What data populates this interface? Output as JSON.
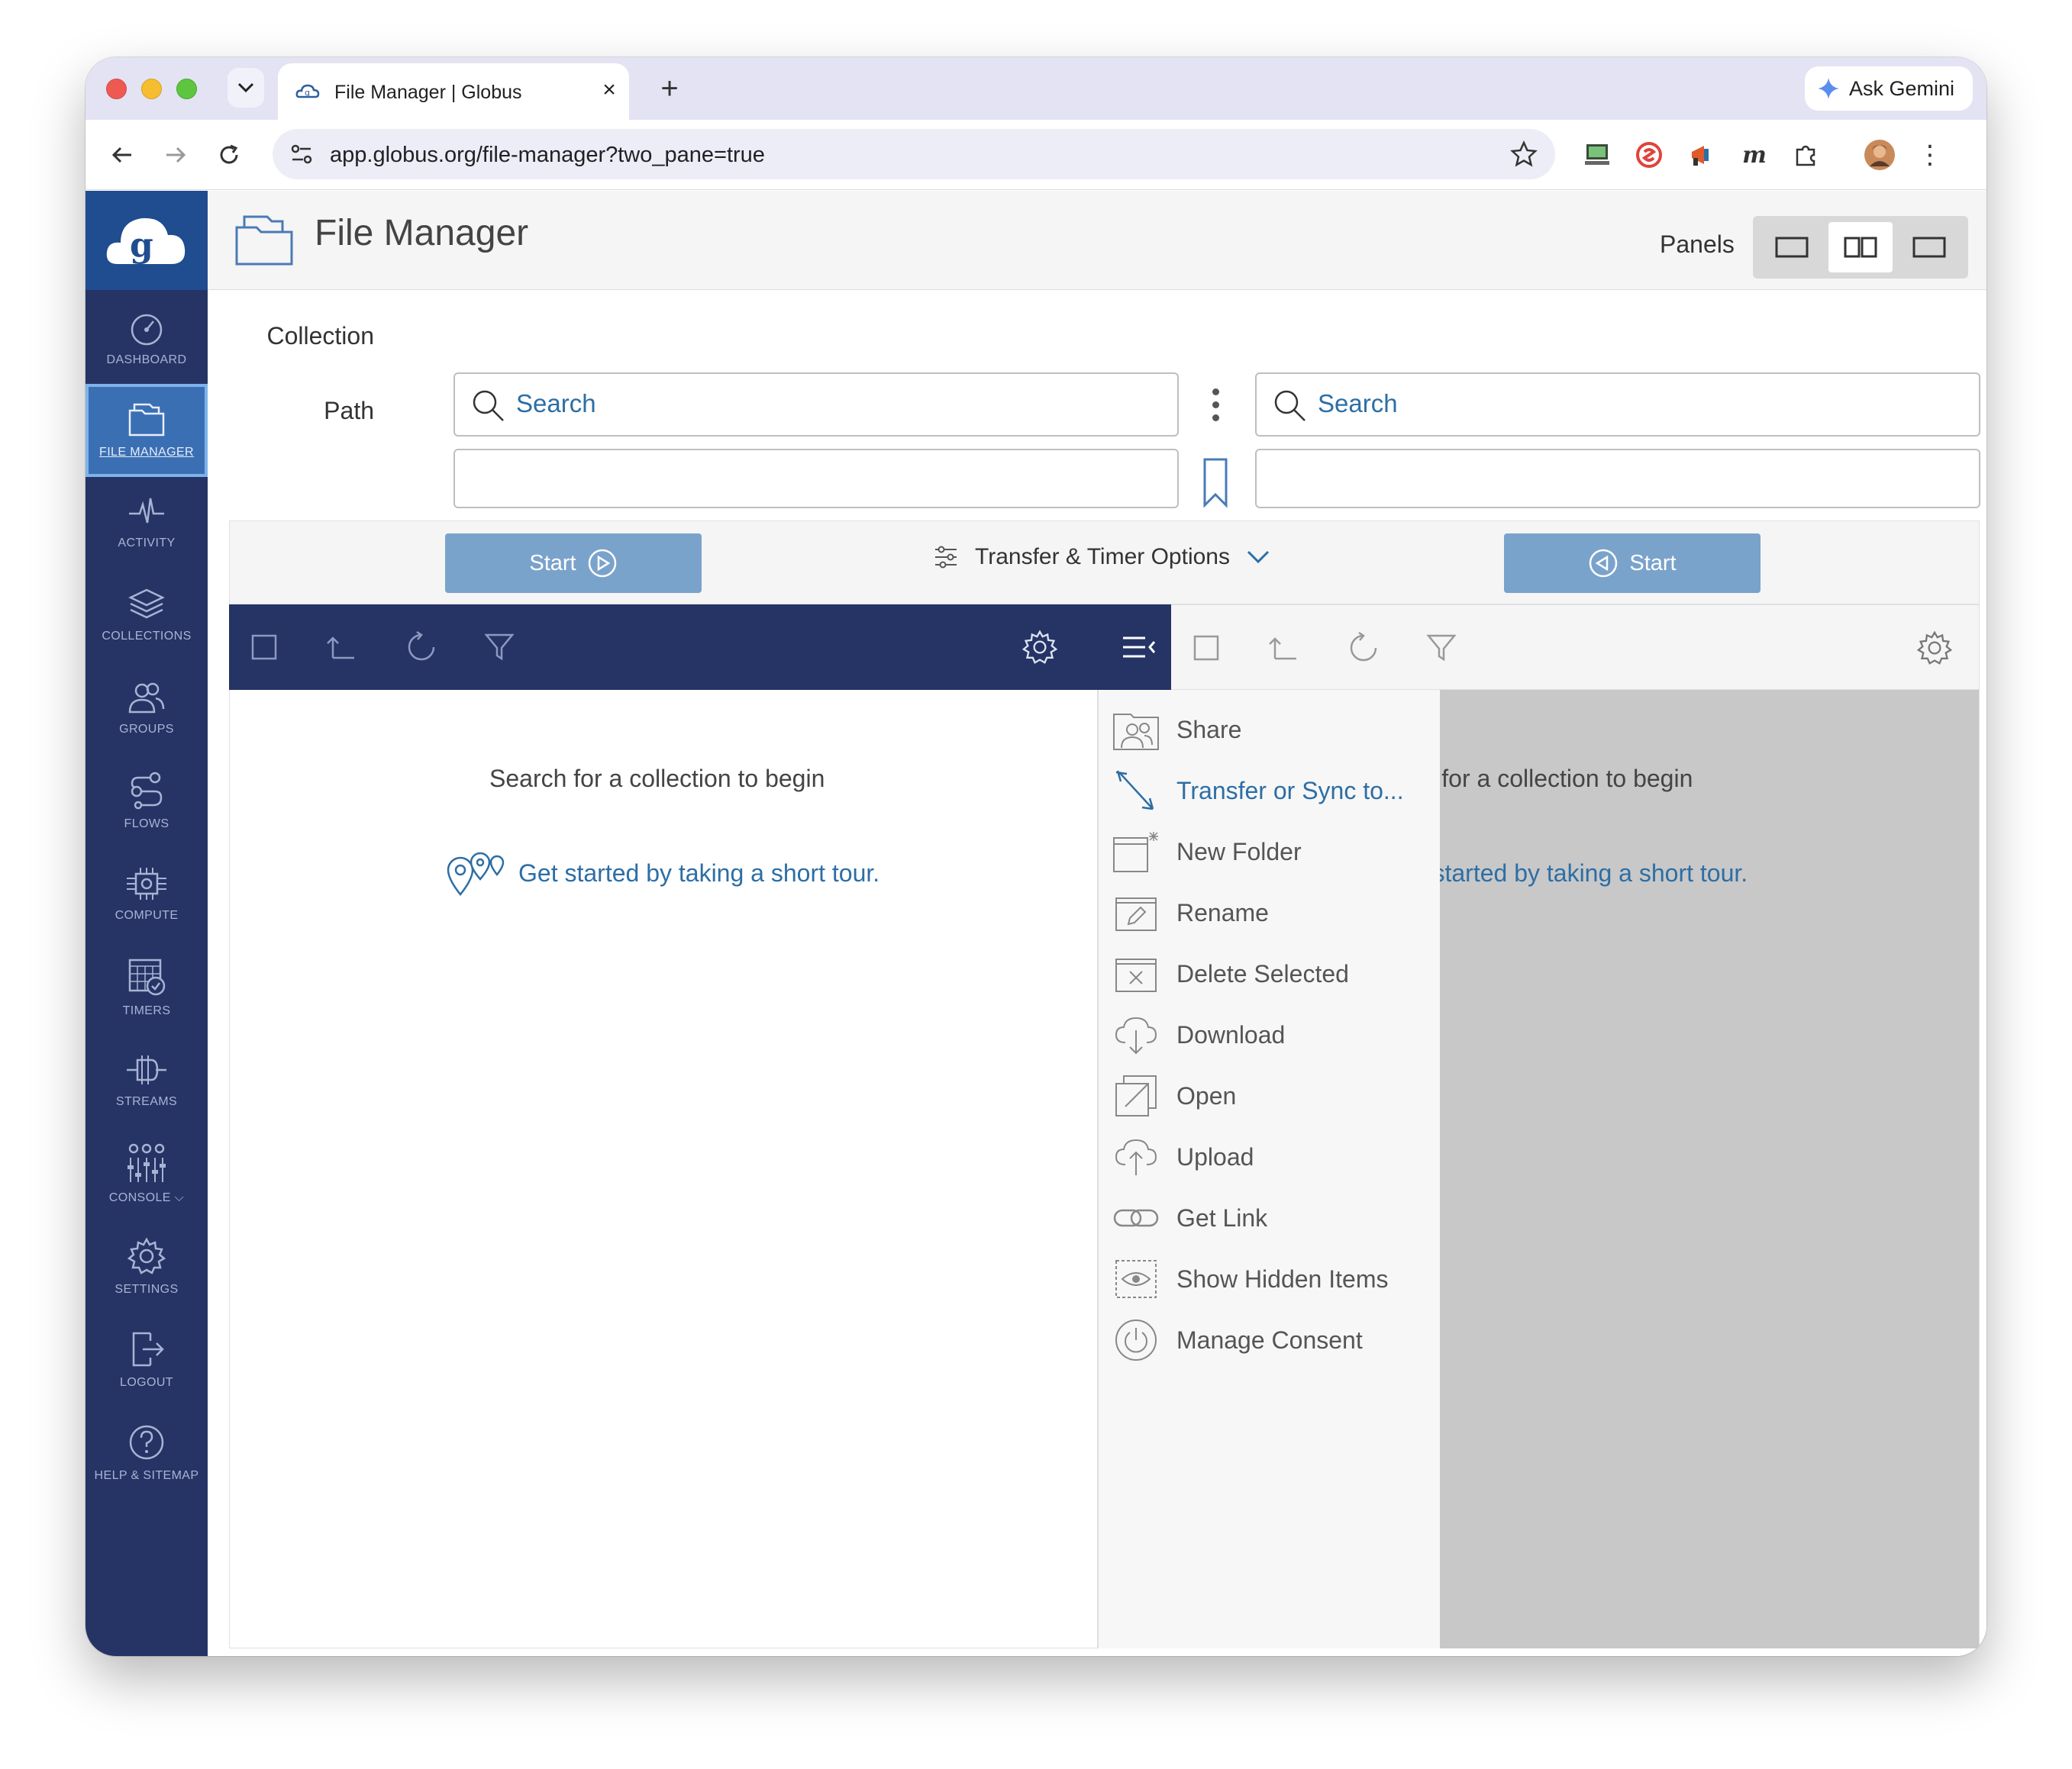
{
  "browser": {
    "tab_title": "File Manager | Globus",
    "url": "app.globus.org/file-manager?two_pane=true",
    "ask_gemini": "Ask Gemini"
  },
  "sidebar": {
    "items": [
      {
        "label": "DASHBOARD",
        "icon": "gauge-icon"
      },
      {
        "label": "FILE MANAGER",
        "icon": "folder-icon"
      },
      {
        "label": "ACTIVITY",
        "icon": "pulse-icon"
      },
      {
        "label": "COLLECTIONS",
        "icon": "layers-icon"
      },
      {
        "label": "GROUPS",
        "icon": "users-icon"
      },
      {
        "label": "FLOWS",
        "icon": "flows-icon"
      },
      {
        "label": "COMPUTE",
        "icon": "chip-icon"
      },
      {
        "label": "TIMERS",
        "icon": "calendar-clock-icon"
      },
      {
        "label": "STREAMS",
        "icon": "streams-icon"
      },
      {
        "label": "CONSOLE",
        "icon": "sliders-icon"
      },
      {
        "label": "SETTINGS",
        "icon": "gear-icon"
      },
      {
        "label": "LOGOUT",
        "icon": "logout-icon"
      },
      {
        "label": "HELP & SITEMAP",
        "icon": "help-icon"
      }
    ]
  },
  "header": {
    "title": "File Manager",
    "panels_label": "Panels"
  },
  "form": {
    "collection_label": "Collection",
    "path_label": "Path",
    "left_search_placeholder": "Search",
    "right_search_placeholder": "Search"
  },
  "transfer": {
    "start_left": "Start",
    "start_right": "Start",
    "options_label": "Transfer & Timer Options"
  },
  "left_pane": {
    "empty_message": "Search for a collection to begin",
    "tour_link": "Get started by taking a short tour."
  },
  "right_pane": {
    "empty_message": "Search for a collection to begin",
    "tour_link": "Get started by taking a short tour."
  },
  "menu": {
    "items": [
      {
        "label": "Share",
        "icon": "share-icon"
      },
      {
        "label": "Transfer or Sync to...",
        "icon": "transfer-arrow-icon"
      },
      {
        "label": "New Folder",
        "icon": "new-folder-icon"
      },
      {
        "label": "Rename",
        "icon": "rename-icon"
      },
      {
        "label": "Delete Selected",
        "icon": "delete-icon"
      },
      {
        "label": "Download",
        "icon": "download-icon"
      },
      {
        "label": "Open",
        "icon": "open-icon"
      },
      {
        "label": "Upload",
        "icon": "upload-icon"
      },
      {
        "label": "Get Link",
        "icon": "link-icon"
      },
      {
        "label": "Show Hidden Items",
        "icon": "eye-icon"
      },
      {
        "label": "Manage Consent",
        "icon": "power-icon"
      }
    ]
  },
  "colors": {
    "sidebar_bg": "#253465",
    "active_nav": "#3a6fb3",
    "accent_blue": "#2d6ea5",
    "start_button": "#7aa3cb"
  }
}
